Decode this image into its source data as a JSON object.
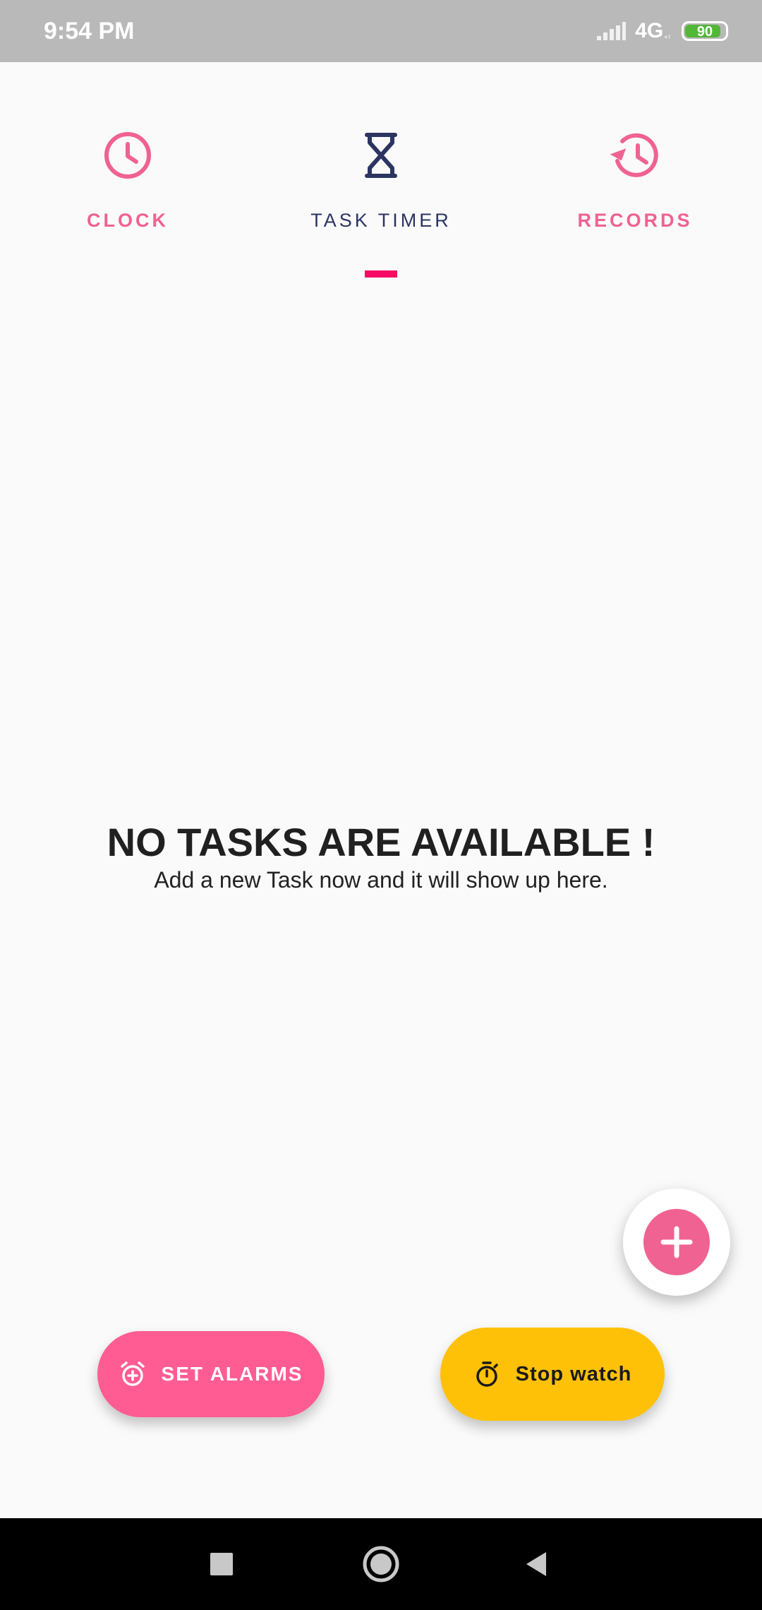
{
  "status_bar": {
    "time": "9:54 PM",
    "network": "4G",
    "network_sub": "₊ₗ",
    "battery_level": "90",
    "battery_fraction": 0.9
  },
  "tabs": [
    {
      "label": "CLOCK",
      "icon": "clock-icon",
      "selected": false
    },
    {
      "label": "TASK TIMER",
      "icon": "hourglass-icon",
      "selected": true
    },
    {
      "label": "RECORDS",
      "icon": "history-icon",
      "selected": false
    }
  ],
  "empty_state": {
    "title": "NO TASKS ARE AVAILABLE !",
    "subtitle": "Add a new Task now and it will show up here."
  },
  "fab": {
    "icon": "plus-icon"
  },
  "buttons": {
    "set_alarms": {
      "label": "SET ALARMS",
      "icon": "alarm-add-icon"
    },
    "stop_watch": {
      "label": "Stop watch",
      "icon": "stopwatch-icon"
    }
  },
  "nav_bar": {
    "recents": "square-icon",
    "home": "circle-icon",
    "back": "triangle-back-icon"
  },
  "colors": {
    "accent_pink": "#f06292",
    "indicator": "#f50a64",
    "selected_navy": "#2c3561",
    "alarm_button": "#ff5c93",
    "stopwatch_button": "#ffc107",
    "battery_green": "#52b636"
  }
}
